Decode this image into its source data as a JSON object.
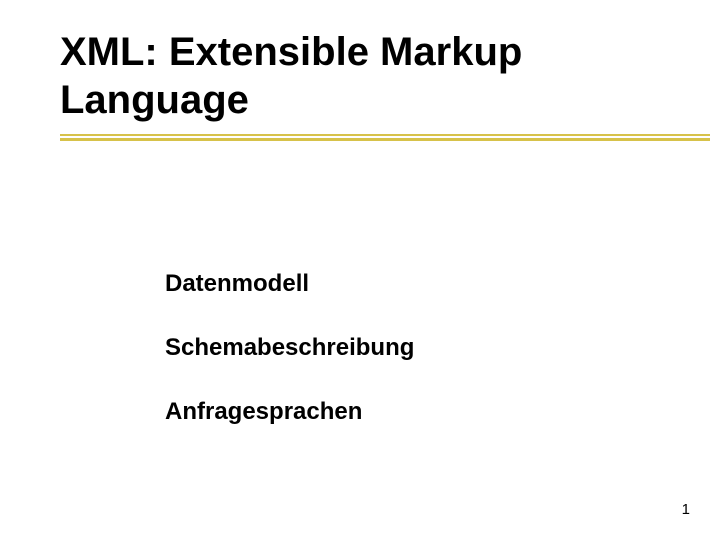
{
  "colors": {
    "underline": "#d7c24a",
    "text": "#000000",
    "background": "#ffffff"
  },
  "title": {
    "line1": "XML: Extensible Markup",
    "line2": "Language"
  },
  "body": {
    "items": [
      "Datenmodell",
      "Schemabeschreibung",
      "Anfragesprachen"
    ]
  },
  "page_number": "1"
}
